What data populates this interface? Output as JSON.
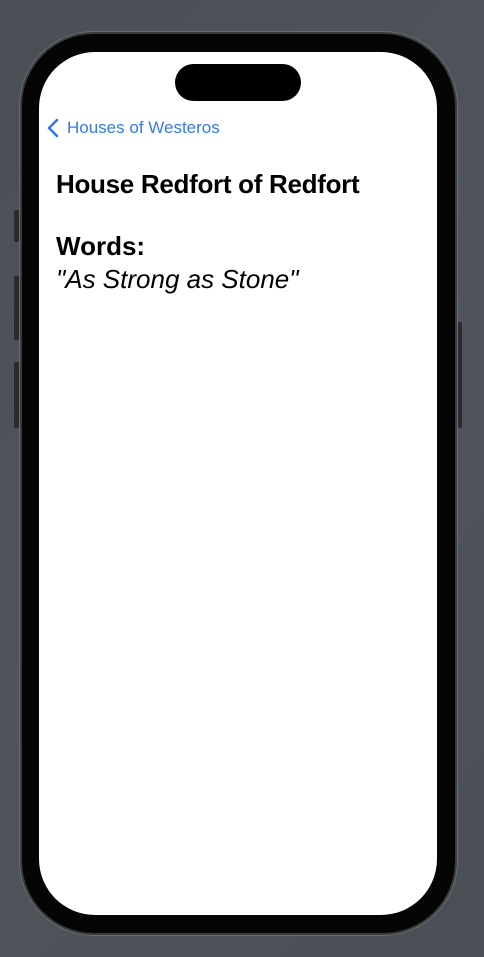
{
  "nav": {
    "back_label": "Houses of Westeros",
    "back_icon": "chevron-left-icon",
    "accent_color": "#3478f6"
  },
  "house": {
    "name": "House Redfort of Redfort",
    "words_label": "Words:",
    "words": "\"As Strong as Stone\""
  }
}
